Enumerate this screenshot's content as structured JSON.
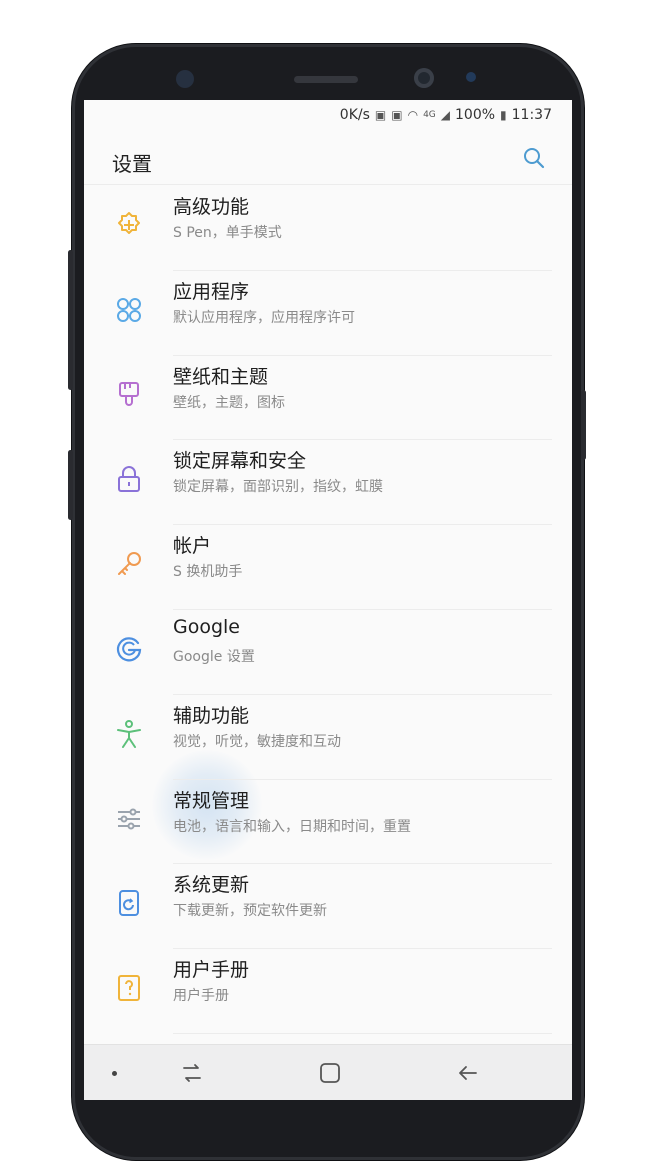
{
  "status_bar": {
    "speed": "0K/s",
    "network": "4G",
    "battery": "100%",
    "time": "11:37"
  },
  "header": {
    "title": "设置",
    "search_icon": "search-icon"
  },
  "settings_items": [
    {
      "title": "高级功能",
      "subtitle": "S Pen，单手模式",
      "icon": "advanced-features-icon",
      "color": "#f0b43a"
    },
    {
      "title": "应用程序",
      "subtitle": "默认应用程序，应用程序许可",
      "icon": "apps-icon",
      "color": "#5aa9e6"
    },
    {
      "title": "壁纸和主题",
      "subtitle": "壁纸，主题，图标",
      "icon": "wallpaper-brush-icon",
      "color": "#b56fd0"
    },
    {
      "title": "锁定屏幕和安全",
      "subtitle": "锁定屏幕，面部识别，指纹，虹膜",
      "icon": "lock-icon",
      "color": "#8a72d8"
    },
    {
      "title": "帐户",
      "subtitle": "S 换机助手",
      "icon": "key-icon",
      "color": "#f09a50"
    },
    {
      "title": "Google",
      "subtitle": "Google 设置",
      "icon": "google-icon",
      "color": "#4d8fe0"
    },
    {
      "title": "辅助功能",
      "subtitle": "视觉，听觉，敏捷度和互动",
      "icon": "accessibility-icon",
      "color": "#5cc07a"
    },
    {
      "title": "常规管理",
      "subtitle": "电池，语言和输入，日期和时间，重置",
      "icon": "sliders-icon",
      "color": "#9aa3ad"
    },
    {
      "title": "系统更新",
      "subtitle": "下载更新，预定软件更新",
      "icon": "system-update-icon",
      "color": "#4d8fe0"
    },
    {
      "title": "用户手册",
      "subtitle": "用户手册",
      "icon": "user-manual-icon",
      "color": "#f0b43a"
    }
  ],
  "nav_bar": {
    "recents": "recents-icon",
    "home": "home-icon",
    "back": "back-icon"
  }
}
